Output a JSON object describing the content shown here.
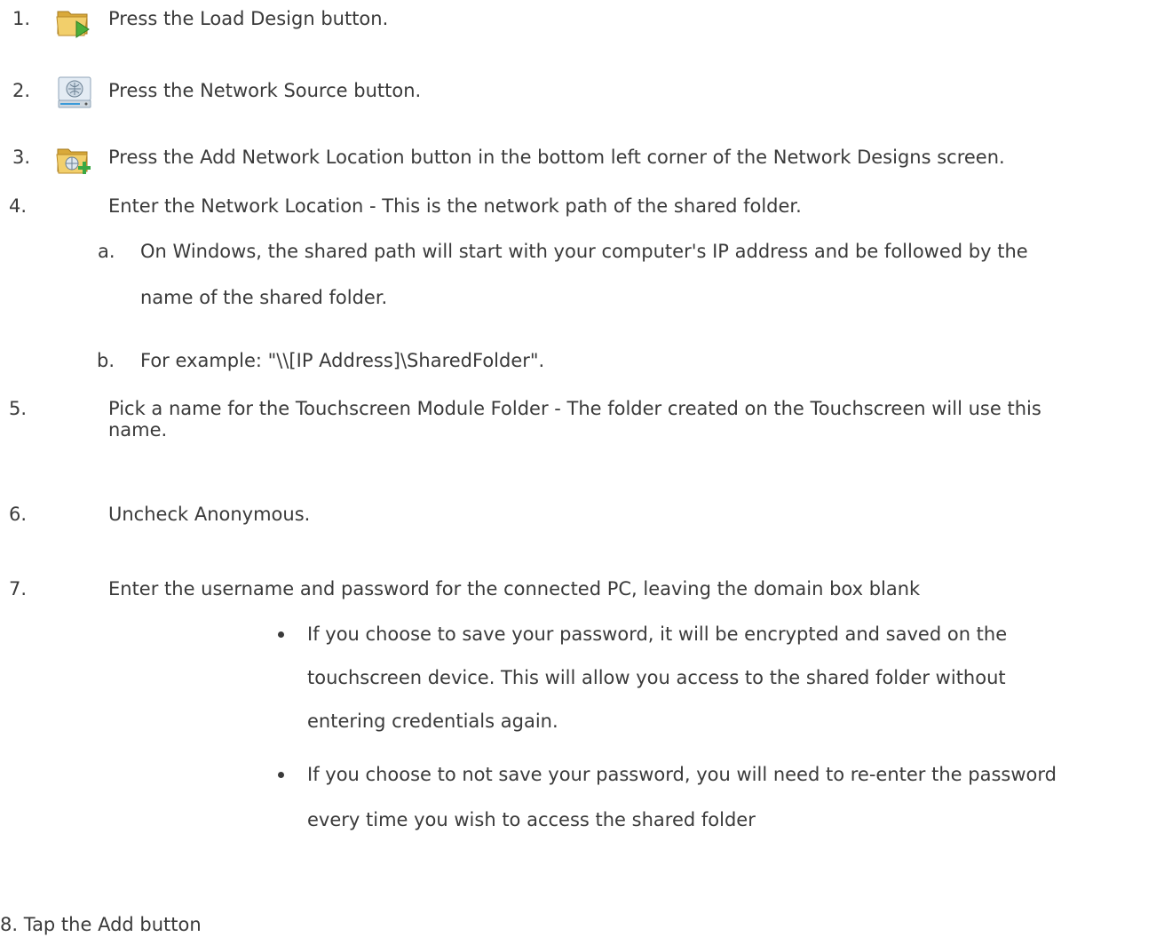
{
  "steps": [
    {
      "num": "1.",
      "text": "Press the Load Design button.",
      "icon": "load-design-folder-icon"
    },
    {
      "num": "2.",
      "text": "Press the Network Source button.",
      "icon": "network-source-drive-icon"
    },
    {
      "num": "3.",
      "text": "Press the Add Network Location button in the bottom left corner of the Network Designs screen.",
      "icon": "add-network-location-folder-icon"
    },
    {
      "num": "4.",
      "text": "Enter the Network Location - This is the network path of the shared folder."
    },
    {
      "num": "5.",
      "text_line1": "Pick a name for the Touchscreen Module Folder - The folder created on the Touchscreen will use this",
      "text_line2": "name."
    },
    {
      "num": "6.",
      "text": "Uncheck Anonymous."
    },
    {
      "num": "7.",
      "text": "Enter the username and password for the connected PC, leaving the domain box blank"
    },
    {
      "text": "8. Tap the Add button"
    }
  ],
  "substeps": [
    {
      "label": "a.",
      "line1": "On Windows, the shared path will start with your computer's IP address and be followed by the",
      "line2": "name of the shared folder."
    },
    {
      "label": "b.",
      "line1": "For example: \"\\\\[IP Address]\\SharedFolder\"."
    }
  ],
  "bullets": [
    {
      "line1": "If you choose to save your password, it will be encrypted and saved on the",
      "line2": "touchscreen device. This will allow you access to the shared folder without",
      "line3": "entering credentials again."
    },
    {
      "line1": "If you choose to not save your password, you will need to re-enter the password",
      "line2": "every time you wish to access the shared folder"
    }
  ]
}
